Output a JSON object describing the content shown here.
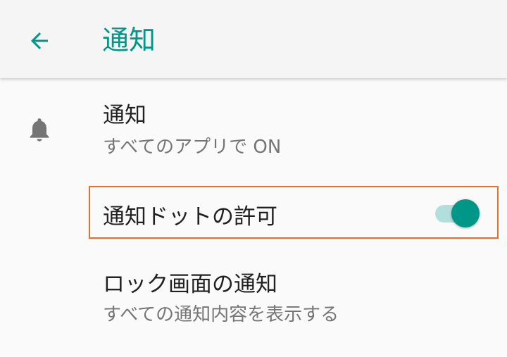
{
  "toolbar": {
    "title": "通知",
    "back_icon": "arrow-back-icon"
  },
  "settings": [
    {
      "icon": "bell-icon",
      "title": "通知",
      "summary": "すべてのアプリで ON"
    },
    {
      "title": "通知ドットの許可",
      "toggle": {
        "state": "on"
      }
    },
    {
      "title": "ロック画面の通知",
      "summary": "すべての通知内容を表示する"
    }
  ],
  "colors": {
    "accent": "#009688",
    "accent_light": "#b2dfdb",
    "highlight_border": "#e8702a",
    "icon_gray": "#757575"
  }
}
